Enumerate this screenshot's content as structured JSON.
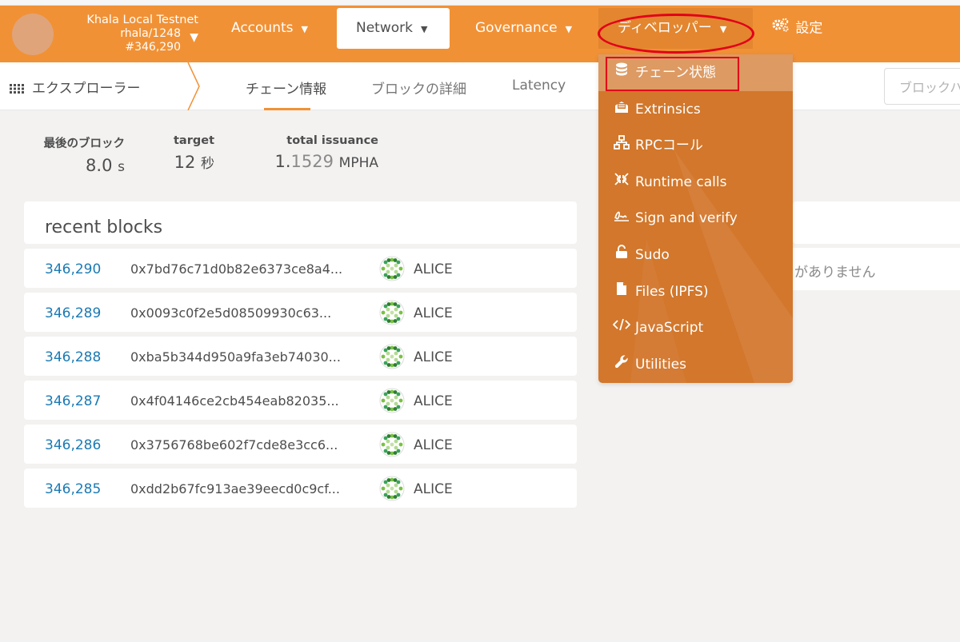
{
  "topbar": {
    "chain_name": "Khala Local Testnet",
    "runtime": "rhala/1248",
    "best_block": "#346,290",
    "nav": {
      "accounts": "Accounts",
      "network": "Network",
      "governance": "Governance",
      "developer": "ディベロッパー",
      "settings": "設定"
    }
  },
  "subnav": {
    "section": "エクスプローラー",
    "tabs": [
      "チェーン情報",
      "ブロックの詳細",
      "Latency"
    ],
    "active_tab": "チェーン情報",
    "search_placeholder": "ブロックハッシュ"
  },
  "summary": {
    "last_block_label": "最後のブロック",
    "last_block_value": "8.0",
    "last_block_unit": "s",
    "target_label": "target",
    "target_value": "12",
    "target_unit": "秒",
    "issuance_label": "total issuance",
    "issuance_int": "1.",
    "issuance_frac": "1529",
    "issuance_unit": "MPHA"
  },
  "recent_blocks": {
    "title": "recent blocks",
    "rows": [
      {
        "number": "346,290",
        "hash": "0x7bd76c71d0b82e6373ce8a4...",
        "author": "ALICE"
      },
      {
        "number": "346,289",
        "hash": "0x0093c0f2e5d08509930c63...",
        "author": "ALICE"
      },
      {
        "number": "346,288",
        "hash": "0xba5b344d950a9fa3eb74030...",
        "author": "ALICE"
      },
      {
        "number": "346,287",
        "hash": "0x4f04146ce2cb454eab82035...",
        "author": "ALICE"
      },
      {
        "number": "346,286",
        "hash": "0x3756768be602f7cde8e3cc6...",
        "author": "ALICE"
      },
      {
        "number": "346,285",
        "hash": "0xdd2b67fc913ae39eecd0c9cf...",
        "author": "ALICE"
      }
    ]
  },
  "events": {
    "empty_text": "がありません"
  },
  "developer_menu": {
    "items": [
      {
        "label": "チェーン状態",
        "icon": "database-icon"
      },
      {
        "label": "Extrinsics",
        "icon": "envelope-open-icon"
      },
      {
        "label": "RPCコール",
        "icon": "network-icon"
      },
      {
        "label": "Runtime calls",
        "icon": "compress-icon"
      },
      {
        "label": "Sign and verify",
        "icon": "signature-icon"
      },
      {
        "label": "Sudo",
        "icon": "unlock-icon"
      },
      {
        "label": "Files (IPFS)",
        "icon": "file-icon"
      },
      {
        "label": "JavaScript",
        "icon": "code-icon"
      },
      {
        "label": "Utilities",
        "icon": "wrench-icon"
      }
    ]
  },
  "colors": {
    "accent": "#f19135",
    "dropdown": "#d2772b",
    "link": "#1b7ab3",
    "annotation": "#e2001a"
  }
}
